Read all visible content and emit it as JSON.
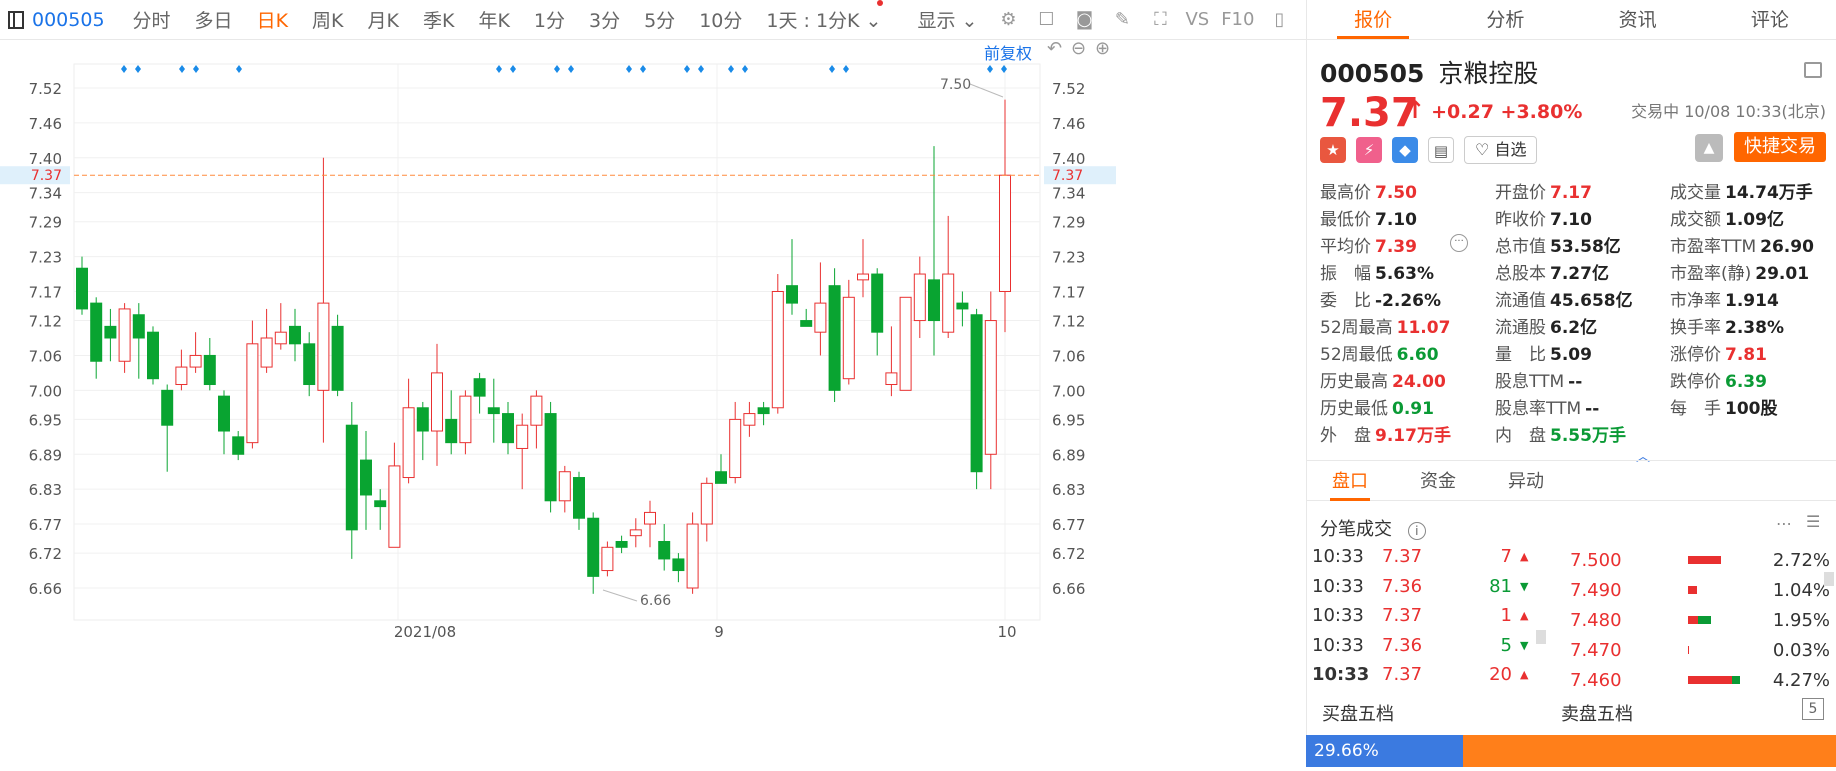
{
  "toolbar": {
    "code": "000505",
    "tabs": [
      "分时",
      "多日",
      "日K",
      "周K",
      "月K",
      "季K",
      "年K",
      "1分",
      "3分",
      "5分",
      "10分"
    ],
    "active_tab": "日K",
    "interval_label": "1天 : 1分K",
    "display_label": "显示",
    "vs_label": "VS",
    "f10_label": "F10"
  },
  "chart_header": {
    "adjust_label": "前复权"
  },
  "chart_data": {
    "type": "candlestick",
    "y_ticks": [
      "7.52",
      "7.46",
      "7.40",
      "7.34",
      "7.29",
      "7.23",
      "7.17",
      "7.12",
      "7.06",
      "7.00",
      "6.95",
      "6.89",
      "6.83",
      "6.77",
      "6.72",
      "6.66"
    ],
    "x_labels": [
      "2021/08",
      "9",
      "10"
    ],
    "ylim": [
      6.62,
      7.56
    ],
    "last_price_label": "7.37",
    "high_annotation": "7.50",
    "low_annotation": "6.66",
    "candles": [
      [
        7.21,
        7.14,
        7.23,
        7.13
      ],
      [
        7.15,
        7.05,
        7.16,
        7.02
      ],
      [
        7.11,
        7.09,
        7.14,
        7.05
      ],
      [
        7.05,
        7.14,
        7.15,
        7.03
      ],
      [
        7.13,
        7.09,
        7.15,
        7.02
      ],
      [
        7.1,
        7.02,
        7.11,
        7.01
      ],
      [
        7.0,
        6.94,
        7.01,
        6.86
      ],
      [
        7.01,
        7.04,
        7.07,
        7.0
      ],
      [
        7.04,
        7.06,
        7.1,
        7.03
      ],
      [
        7.06,
        7.01,
        7.09,
        7.0
      ],
      [
        6.99,
        6.93,
        7.0,
        6.89
      ],
      [
        6.92,
        6.89,
        6.93,
        6.88
      ],
      [
        6.91,
        7.08,
        7.12,
        6.9
      ],
      [
        7.04,
        7.09,
        7.14,
        7.03
      ],
      [
        7.08,
        7.1,
        7.15,
        7.07
      ],
      [
        7.11,
        7.08,
        7.14,
        7.05
      ],
      [
        7.08,
        7.01,
        7.1,
        6.99
      ],
      [
        7.0,
        7.15,
        7.4,
        6.91
      ],
      [
        7.11,
        7.0,
        7.13,
        6.99
      ],
      [
        6.94,
        6.76,
        6.98,
        6.71
      ],
      [
        6.88,
        6.82,
        6.93,
        6.76
      ],
      [
        6.81,
        6.8,
        6.83,
        6.76
      ],
      [
        6.73,
        6.87,
        6.91,
        6.73
      ],
      [
        6.85,
        6.97,
        7.02,
        6.84
      ],
      [
        6.97,
        6.93,
        6.98,
        6.88
      ],
      [
        6.93,
        7.03,
        7.08,
        6.87
      ],
      [
        6.95,
        6.91,
        7.0,
        6.89
      ],
      [
        6.91,
        6.99,
        7.0,
        6.89
      ],
      [
        7.02,
        6.99,
        7.03,
        6.96
      ],
      [
        6.97,
        6.96,
        7.02,
        6.91
      ],
      [
        6.96,
        6.91,
        6.98,
        6.89
      ],
      [
        6.9,
        6.94,
        6.96,
        6.83
      ],
      [
        6.94,
        6.99,
        7.0,
        6.9
      ],
      [
        6.96,
        6.81,
        6.98,
        6.79
      ],
      [
        6.81,
        6.86,
        6.87,
        6.79
      ],
      [
        6.85,
        6.78,
        6.86,
        6.76
      ],
      [
        6.78,
        6.68,
        6.79,
        6.65
      ],
      [
        6.69,
        6.73,
        6.74,
        6.68
      ],
      [
        6.74,
        6.73,
        6.75,
        6.72
      ],
      [
        6.75,
        6.76,
        6.78,
        6.73
      ],
      [
        6.77,
        6.79,
        6.81,
        6.73
      ],
      [
        6.74,
        6.71,
        6.77,
        6.69
      ],
      [
        6.71,
        6.69,
        6.72,
        6.67
      ],
      [
        6.66,
        6.77,
        6.79,
        6.65
      ],
      [
        6.77,
        6.84,
        6.85,
        6.74
      ],
      [
        6.86,
        6.84,
        6.89,
        6.84
      ],
      [
        6.85,
        6.95,
        6.98,
        6.84
      ],
      [
        6.94,
        6.96,
        6.98,
        6.92
      ],
      [
        6.97,
        6.96,
        6.98,
        6.94
      ],
      [
        6.97,
        7.17,
        7.2,
        6.96
      ],
      [
        7.18,
        7.15,
        7.26,
        7.13
      ],
      [
        7.12,
        7.11,
        7.14,
        7.11
      ],
      [
        7.1,
        7.15,
        7.22,
        7.06
      ],
      [
        7.18,
        7.0,
        7.21,
        6.98
      ],
      [
        7.02,
        7.16,
        7.19,
        7.01
      ],
      [
        7.19,
        7.2,
        7.26,
        7.16
      ],
      [
        7.2,
        7.1,
        7.21,
        7.06
      ],
      [
        7.01,
        7.03,
        7.11,
        6.99
      ],
      [
        7.0,
        7.16,
        7.16,
        7.0
      ],
      [
        7.12,
        7.2,
        7.23,
        7.09
      ],
      [
        7.19,
        7.12,
        7.42,
        7.06
      ],
      [
        7.1,
        7.2,
        7.3,
        7.09
      ],
      [
        7.15,
        7.14,
        7.17,
        7.11
      ],
      [
        7.13,
        6.86,
        7.14,
        6.83
      ],
      [
        6.89,
        7.12,
        7.17,
        6.83
      ],
      [
        7.17,
        7.37,
        7.5,
        7.1
      ]
    ]
  },
  "stock": {
    "code": "000505",
    "name": "京粮控股",
    "price": "7.37",
    "change": "+0.27",
    "change_pct": "+3.80%",
    "status": "交易中 10/08 10:33(北京)"
  },
  "right_tabs": [
    "报价",
    "分析",
    "资讯",
    "评论"
  ],
  "watch_label": "自选",
  "quick_trade_label": "快捷交易",
  "quote": [
    [
      {
        "k": "最高价",
        "v": "7.50",
        "c": "red"
      },
      {
        "k": "开盘价",
        "v": "7.17",
        "c": "red"
      },
      {
        "k": "成交量",
        "v": "14.74万手",
        "c": ""
      }
    ],
    [
      {
        "k": "最低价",
        "v": "7.10",
        "c": ""
      },
      {
        "k": "昨收价",
        "v": "7.10",
        "c": ""
      },
      {
        "k": "成交额",
        "v": "1.09亿",
        "c": ""
      }
    ],
    [
      {
        "k": "平均价",
        "v": "7.39",
        "c": "red"
      },
      {
        "k": "总市值",
        "v": "53.58亿",
        "c": ""
      },
      {
        "k": "市盈率TTM",
        "v": "26.90",
        "c": ""
      }
    ],
    [
      {
        "k": "振　幅",
        "v": "5.63%",
        "c": ""
      },
      {
        "k": "总股本",
        "v": "7.27亿",
        "c": ""
      },
      {
        "k": "市盈率(静)",
        "v": "29.01",
        "c": ""
      }
    ],
    [
      {
        "k": "委　比",
        "v": "-2.26%",
        "c": ""
      },
      {
        "k": "流通值",
        "v": "45.658亿",
        "c": ""
      },
      {
        "k": "市净率",
        "v": "1.914",
        "c": ""
      }
    ],
    [
      {
        "k": "52周最高",
        "v": "11.07",
        "c": "red"
      },
      {
        "k": "流通股",
        "v": "6.2亿",
        "c": ""
      },
      {
        "k": "换手率",
        "v": "2.38%",
        "c": ""
      }
    ],
    [
      {
        "k": "52周最低",
        "v": "6.60",
        "c": "grn"
      },
      {
        "k": "量　比",
        "v": "5.09",
        "c": ""
      },
      {
        "k": "涨停价",
        "v": "7.81",
        "c": "red"
      }
    ],
    [
      {
        "k": "历史最高",
        "v": "24.00",
        "c": "red"
      },
      {
        "k": "股息TTM",
        "v": "--",
        "c": ""
      },
      {
        "k": "跌停价",
        "v": "6.39",
        "c": "grn"
      }
    ],
    [
      {
        "k": "历史最低",
        "v": "0.91",
        "c": "grn"
      },
      {
        "k": "股息率TTM",
        "v": "--",
        "c": ""
      },
      {
        "k": "每　手",
        "v": "100股",
        "c": ""
      }
    ],
    [
      {
        "k": "外　盘",
        "v": "9.17万手",
        "c": "red"
      },
      {
        "k": "内　盘",
        "v": "5.55万手",
        "c": "grn"
      },
      {
        "k": "",
        "v": "",
        "c": ""
      }
    ]
  ],
  "sub_tabs": [
    "盘口",
    "资金",
    "异动"
  ],
  "trades_title": "分笔成交",
  "trades": [
    {
      "time": "10:33",
      "price": "7.37",
      "vol": "7",
      "dir": "up"
    },
    {
      "time": "10:33",
      "price": "7.36",
      "vol": "81",
      "dir": "down"
    },
    {
      "time": "10:33",
      "price": "7.37",
      "vol": "1",
      "dir": "up"
    },
    {
      "time": "10:33",
      "price": "7.36",
      "vol": "5",
      "dir": "down"
    },
    {
      "time": "10:33",
      "price": "7.37",
      "vol": "20",
      "dir": "up"
    }
  ],
  "book": [
    {
      "price": "7.500",
      "pct": "2.72%",
      "r": 0.64,
      "g": 0
    },
    {
      "price": "7.490",
      "pct": "1.04%",
      "r": 0.18,
      "g": 0
    },
    {
      "price": "7.480",
      "pct": "1.95%",
      "r": 0.2,
      "g": 0.25
    },
    {
      "price": "7.470",
      "pct": "0.03%",
      "r": 0.02,
      "g": 0
    },
    {
      "price": "7.460",
      "pct": "4.27%",
      "r": 0.85,
      "g": 0.15
    }
  ],
  "buy5_label": "买盘五档",
  "sell5_label": "卖盘五档",
  "five_icon": "5",
  "buy_ratio": "29.66%",
  "buy_ratio_value": 0.2966
}
